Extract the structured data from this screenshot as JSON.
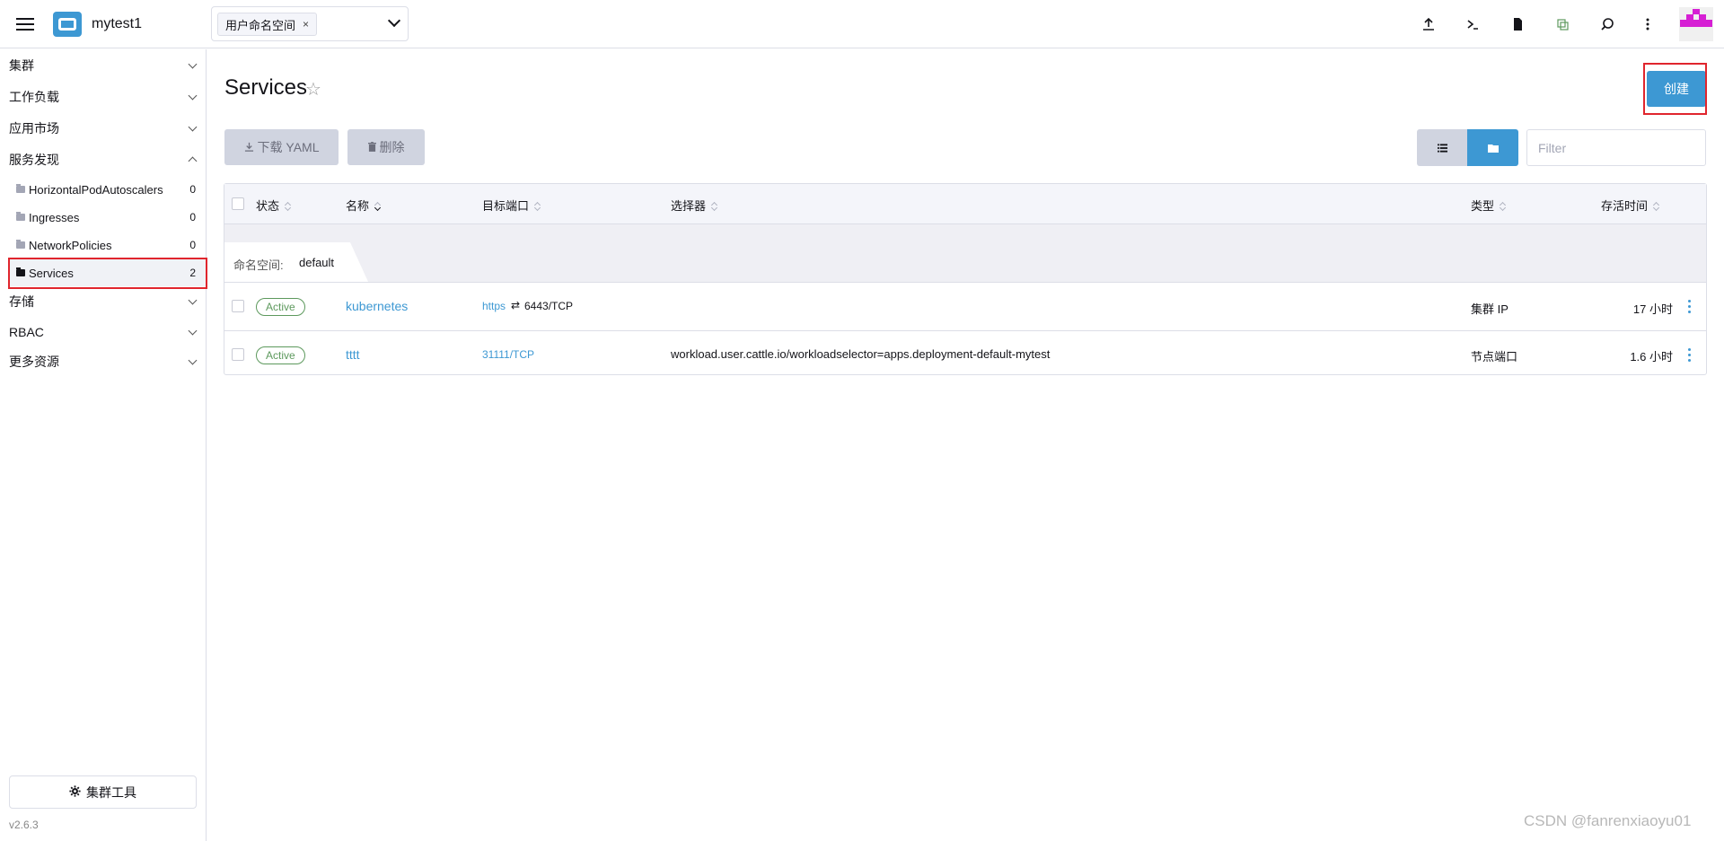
{
  "header": {
    "app_title": "mytest1",
    "namespace_chip": "用户命名空间",
    "namespace_remove": "×",
    "icons": [
      "menu-icon",
      "cluster-logo-icon",
      "upload-icon",
      "terminal-icon",
      "file-icon",
      "copy-icon",
      "search-icon",
      "more-vert-icon"
    ]
  },
  "sidebar": {
    "groups": [
      {
        "label": "集群"
      },
      {
        "label": "工作负载"
      },
      {
        "label": "应用市场"
      },
      {
        "label": "服务发现"
      },
      {
        "label": "存储"
      },
      {
        "label": "RBAC"
      },
      {
        "label": "更多资源"
      }
    ],
    "items": [
      {
        "label": "HorizontalPodAutoscalers",
        "count": "0"
      },
      {
        "label": "Ingresses",
        "count": "0"
      },
      {
        "label": "NetworkPolicies",
        "count": "0"
      },
      {
        "label": "Services",
        "count": "2"
      }
    ],
    "tools_label": "集群工具",
    "version": "v2.6.3"
  },
  "main": {
    "title": "Services",
    "create_label": "创建",
    "download_label": "下载 YAML",
    "delete_label": "删除",
    "filter_placeholder": "Filter",
    "table": {
      "headers": {
        "state": "状态",
        "name": "名称",
        "target_port": "目标端口",
        "selector": "选择器",
        "type": "类型",
        "age": "存活时间"
      },
      "group": {
        "label": "命名空间:",
        "value": "default"
      },
      "rows": [
        {
          "state": "Active",
          "name": "kubernetes",
          "port_link": "https",
          "port_arrow": "⇄",
          "port_value": "6443/TCP",
          "selector": "",
          "type": "集群 IP",
          "age": "17 小时"
        },
        {
          "state": "Active",
          "name": "tttt",
          "port_link": "31111/TCP",
          "port_arrow": "",
          "port_value": "",
          "selector": "workload.user.cattle.io/workloadselector=apps.deployment-default-mytest",
          "type": "节点端口",
          "age": "1.6 小时"
        }
      ]
    }
  },
  "watermark": "CSDN @fanrenxiaoyu01",
  "colors": {
    "accent": "#3d98d3",
    "active_badge": "#5d995d",
    "highlight": "#e0252d"
  }
}
